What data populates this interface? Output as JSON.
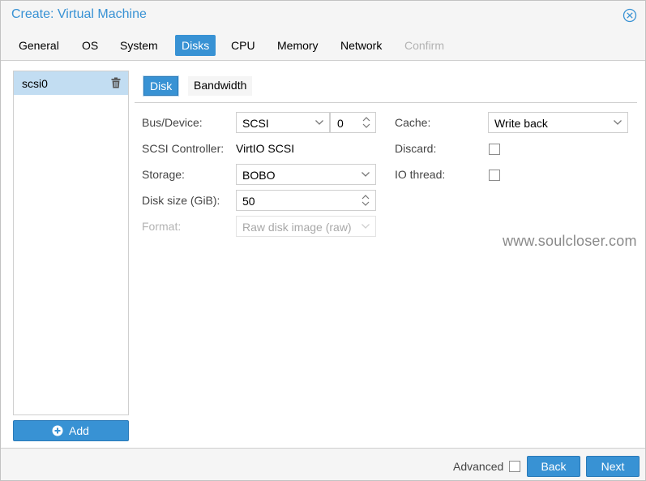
{
  "window": {
    "title": "Create: Virtual Machine"
  },
  "tabs": [
    {
      "label": "General"
    },
    {
      "label": "OS"
    },
    {
      "label": "System"
    },
    {
      "label": "Disks"
    },
    {
      "label": "CPU"
    },
    {
      "label": "Memory"
    },
    {
      "label": "Network"
    },
    {
      "label": "Confirm"
    }
  ],
  "disk_list": {
    "items": [
      {
        "label": "scsi0"
      }
    ],
    "add_label": "Add"
  },
  "subtabs": [
    {
      "label": "Disk"
    },
    {
      "label": "Bandwidth"
    }
  ],
  "form": {
    "bus_device": {
      "label": "Bus/Device:",
      "bus": "SCSI",
      "device": "0"
    },
    "scsi_controller": {
      "label": "SCSI Controller:",
      "value": "VirtIO SCSI"
    },
    "storage": {
      "label": "Storage:",
      "value": "BOBO"
    },
    "disk_size": {
      "label": "Disk size (GiB):",
      "value": "50"
    },
    "format": {
      "label": "Format:",
      "value": "Raw disk image (raw)"
    },
    "cache": {
      "label": "Cache:",
      "value": "Write back"
    },
    "discard": {
      "label": "Discard:",
      "checked": false
    },
    "io_thread": {
      "label": "IO thread:",
      "checked": false
    }
  },
  "watermark": "www.soulcloser.com",
  "footer": {
    "advanced_label": "Advanced",
    "advanced_checked": false,
    "back_label": "Back",
    "next_label": "Next"
  },
  "colors": {
    "accent": "#3892d4",
    "selected_row": "#c2ddf2",
    "panel_bg": "#f5f5f5",
    "disabled_text": "#b3b3b3"
  }
}
